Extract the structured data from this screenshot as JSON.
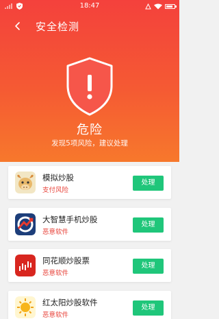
{
  "status_bar": {
    "time": "18:47"
  },
  "nav": {
    "title": "安全检测"
  },
  "scan_result": {
    "level": "危险",
    "summary": "发现5项风险，建议处理"
  },
  "risk_items": [
    {
      "name": "模拟炒股",
      "risk": "支付风险",
      "action": "处理",
      "icon": "cow-icon"
    },
    {
      "name": "大智慧手机炒股",
      "risk": "恶意软件",
      "action": "处理",
      "icon": "dzh-logo-icon"
    },
    {
      "name": "同花顺炒股票",
      "risk": "恶意软件",
      "action": "处理",
      "icon": "stock-chart-icon"
    },
    {
      "name": "红太阳炒股软件",
      "risk": "恶意软件",
      "action": "处理",
      "icon": "sun-icon"
    }
  ],
  "colors": {
    "header_top": "#f4413c",
    "header_bottom": "#f7782c",
    "action_button": "#1fc67a",
    "risk_text": "#e8453c"
  }
}
